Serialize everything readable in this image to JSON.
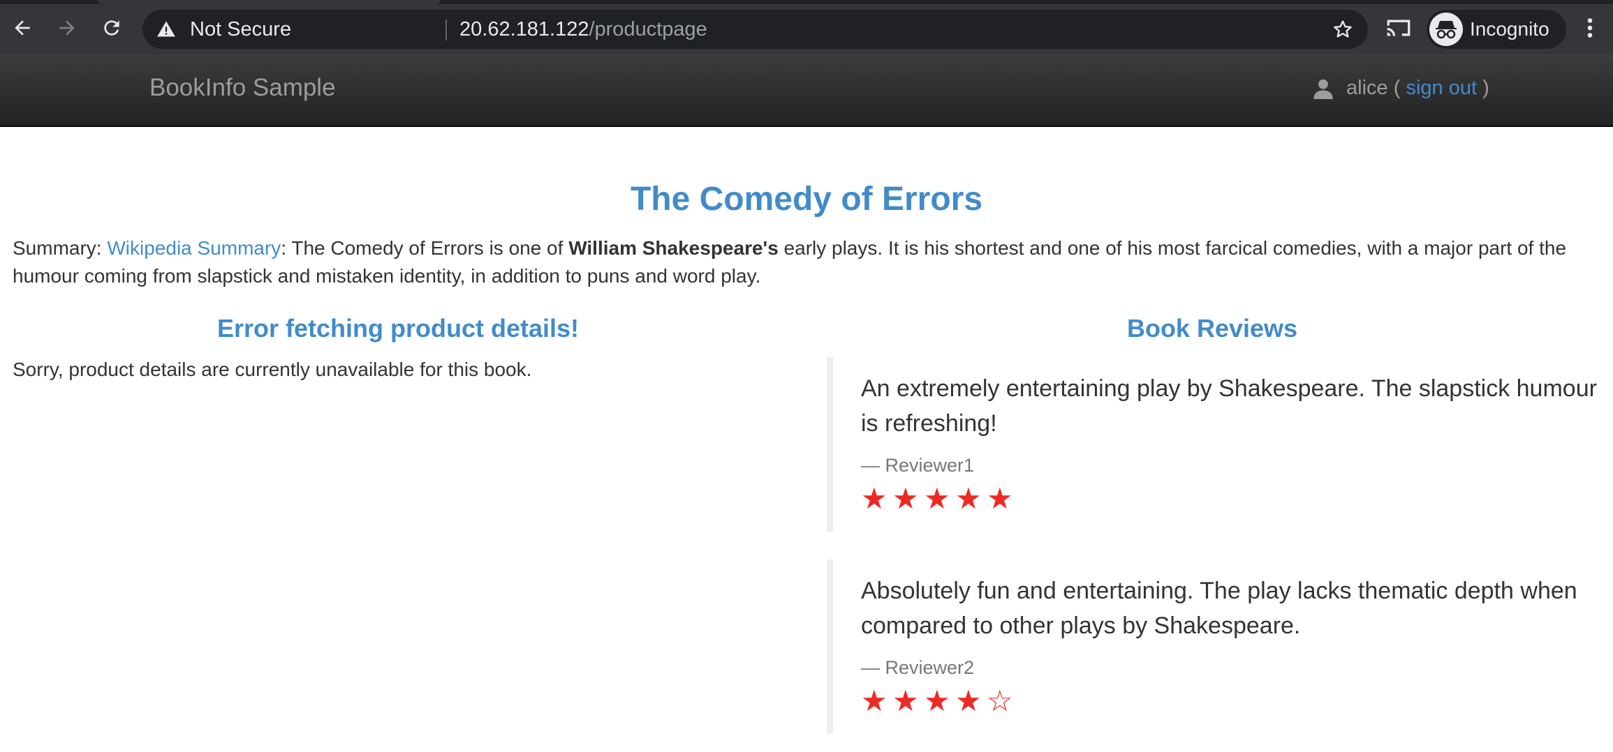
{
  "browser": {
    "security_label": "Not Secure",
    "url_host": "20.62.181.122",
    "url_path": "/productpage",
    "profile_label": "Incognito"
  },
  "navbar": {
    "brand": "BookInfo Sample",
    "user": "alice",
    "paren_open": "(",
    "signout_label": "sign out",
    "paren_close": ")"
  },
  "book": {
    "title": "The Comedy of Errors",
    "summary_prefix": "Summary: ",
    "summary_link": "Wikipedia Summary",
    "summary_text_1": ": The Comedy of Errors is one of ",
    "summary_bold": "William Shakespeare's",
    "summary_text_2": " early plays. It is his shortest and one of his most farcical comedies, with a major part of the humour coming from slapstick and mistaken identity, in addition to puns and word play."
  },
  "details": {
    "heading": "Error fetching product details!",
    "message": "Sorry, product details are currently unavailable for this book."
  },
  "reviews": {
    "heading": "Book Reviews",
    "items": [
      {
        "text": "An extremely entertaining play by Shakespeare. The slapstick humour is refreshing!",
        "reviewer": "— Reviewer1",
        "rating": 5,
        "max_rating": 5
      },
      {
        "text": "Absolutely fun and entertaining. The play lacks thematic depth when compared to other plays by Shakespeare.",
        "reviewer": "— Reviewer2",
        "rating": 4,
        "max_rating": 5
      }
    ],
    "star_color": "#ee2a24"
  },
  "colors": {
    "link": "#428bca",
    "navbar_bg": "#222222"
  }
}
